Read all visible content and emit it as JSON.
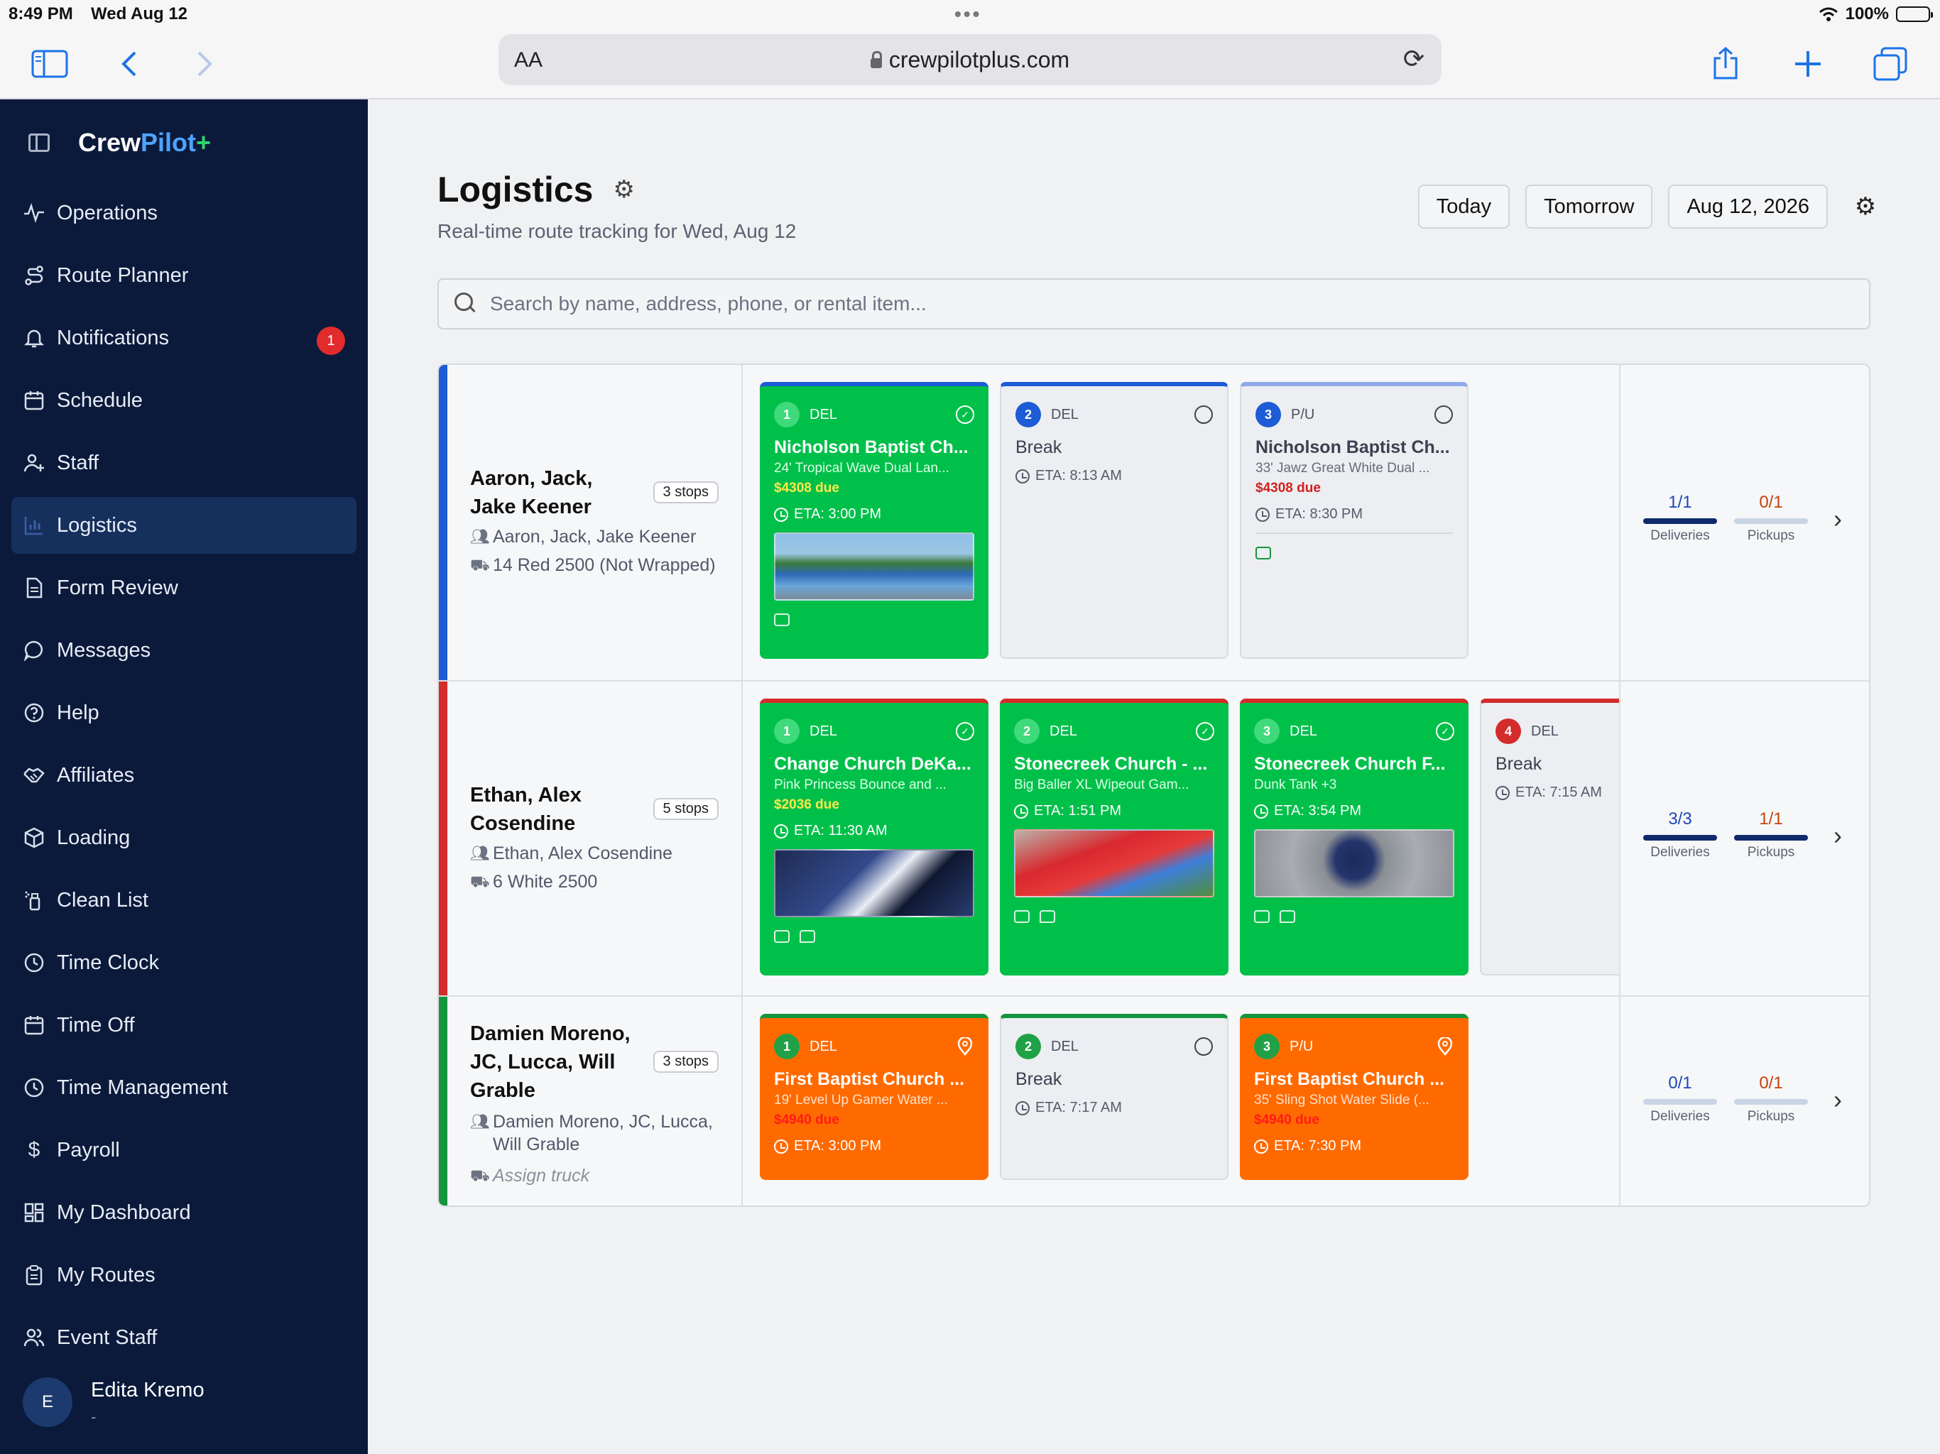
{
  "status_bar": {
    "time": "8:49 PM",
    "date": "Wed Aug 12",
    "battery": "100%"
  },
  "browser": {
    "text_size_label": "AA",
    "url": "crewpilotplus.com"
  },
  "brand": {
    "crew": "Crew",
    "pilot": "Pilot",
    "plus": "+"
  },
  "sidebar": {
    "items": [
      {
        "label": "Operations",
        "icon": "pulse-icon"
      },
      {
        "label": "Route Planner",
        "icon": "route-icon"
      },
      {
        "label": "Notifications",
        "icon": "bell-icon",
        "badge": "1"
      },
      {
        "label": "Schedule",
        "icon": "calendar-icon"
      },
      {
        "label": "Staff",
        "icon": "user-plus-icon"
      },
      {
        "label": "Logistics",
        "icon": "bar-chart-icon",
        "active": true
      },
      {
        "label": "Form Review",
        "icon": "document-icon"
      },
      {
        "label": "Messages",
        "icon": "message-icon"
      },
      {
        "label": "Help",
        "icon": "help-icon"
      },
      {
        "label": "Affiliates",
        "icon": "handshake-icon"
      },
      {
        "label": "Loading",
        "icon": "box-icon"
      },
      {
        "label": "Clean List",
        "icon": "spray-icon"
      },
      {
        "label": "Time Clock",
        "icon": "clock-icon"
      },
      {
        "label": "Time Off",
        "icon": "calendar-icon"
      },
      {
        "label": "Time Management",
        "icon": "clock-icon"
      },
      {
        "label": "Payroll",
        "icon": "dollar-icon"
      },
      {
        "label": "My Dashboard",
        "icon": "grid-icon"
      },
      {
        "label": "My Routes",
        "icon": "clipboard-icon"
      },
      {
        "label": "Event Staff",
        "icon": "users-icon"
      }
    ],
    "user": {
      "initial": "E",
      "name": "Edita Kremo",
      "sub": "-"
    }
  },
  "header": {
    "title": "Logistics",
    "subtitle": "Real-time route tracking for Wed, Aug 12",
    "today": "Today",
    "tomorrow": "Tomorrow",
    "date": "Aug 12, 2026"
  },
  "search": {
    "placeholder": "Search by name, address, phone, or rental item..."
  },
  "routes": [
    {
      "name": "Aaron, Jack, Jake Keener",
      "stops": "3 stops",
      "crew": "Aaron, Jack, Jake Keener",
      "truck": "14 Red 2500 (Not Wrapped)",
      "cards": [
        {
          "num": "1",
          "type": "DEL",
          "title": "Nicholson Baptist Ch...",
          "item": "24' Tropical Wave Dual Lan...",
          "due": "$4308 due",
          "eta": "ETA: 3:00 PM"
        },
        {
          "num": "2",
          "type": "DEL",
          "title": "Break",
          "eta": "ETA: 8:13 AM"
        },
        {
          "num": "3",
          "type": "P/U",
          "title": "Nicholson Baptist Ch...",
          "item": "33' Jawz Great White Dual ...",
          "due": "$4308 due",
          "eta": "ETA: 8:30 PM"
        }
      ],
      "deliveries": "1/1",
      "pickups": "0/1",
      "deliveries_progress": 1.0,
      "pickups_progress": 0.0
    },
    {
      "name": "Ethan, Alex Cosendine",
      "stops": "5 stops",
      "crew": "Ethan, Alex Cosendine",
      "truck": "6 White 2500",
      "cards": [
        {
          "num": "1",
          "type": "DEL",
          "title": "Change Church DeKa...",
          "item": "Pink Princess Bounce and ...",
          "due": "$2036 due",
          "eta": "ETA: 11:30 AM"
        },
        {
          "num": "2",
          "type": "DEL",
          "title": "Stonecreek Church - ...",
          "item": "Big Baller XL Wipeout Gam...",
          "eta": "ETA: 1:51 PM"
        },
        {
          "num": "3",
          "type": "DEL",
          "title": "Stonecreek Church F...",
          "item": "Dunk Tank +3",
          "eta": "ETA: 3:54 PM"
        },
        {
          "num": "4",
          "type": "DEL",
          "title": "Break",
          "eta": "ETA: 7:15 AM"
        }
      ],
      "deliveries": "3/3",
      "pickups": "1/1",
      "deliveries_progress": 1.0,
      "pickups_progress": 1.0
    },
    {
      "name": "Damien Moreno, JC, Lucca, Will Grable",
      "stops": "3 stops",
      "crew": "Damien Moreno, JC, Lucca, Will Grable",
      "truck": "Assign truck",
      "cards": [
        {
          "num": "1",
          "type": "DEL",
          "title": "First Baptist Church ...",
          "item": "19' Level Up Gamer Water ...",
          "due": "$4940 due",
          "eta": "ETA: 3:00 PM"
        },
        {
          "num": "2",
          "type": "DEL",
          "title": "Break",
          "eta": "ETA: 7:17 AM"
        },
        {
          "num": "3",
          "type": "P/U",
          "title": "First Baptist Church ...",
          "item": "35' Sling Shot Water Slide (...",
          "due": "$4940 due",
          "eta": "ETA: 7:30 PM"
        }
      ],
      "deliveries": "0/1",
      "pickups": "0/1",
      "deliveries_progress": 0.0,
      "pickups_progress": 0.0
    }
  ],
  "labels": {
    "deliveries": "Deliveries",
    "pickups": "Pickups"
  },
  "colors": {
    "sidebar": "#0b1a3b",
    "complete": "#00c04a",
    "in_transit": "#ff6a00",
    "route1": "#1e5bd6",
    "route2": "#d42b2b",
    "route3": "#15963e"
  }
}
